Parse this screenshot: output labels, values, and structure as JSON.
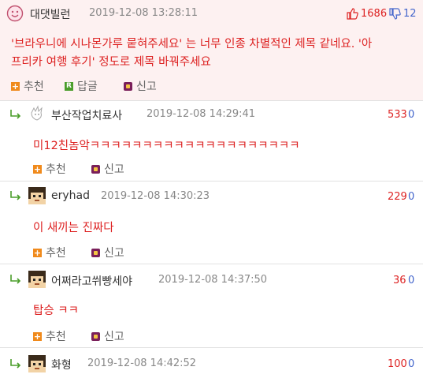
{
  "main_comment": {
    "nickname": "대댓빌런",
    "date": "2019-12-08 13:28:11",
    "upvotes": "1686",
    "downvotes": "12",
    "content_line1": "'브라우니에 시나몬가루 뭍혀주세요' 는 너무 인종 차별적인 제목 같네요. '아",
    "content_line2": "프리카 여행 후기' 정도로 제목 바꿔주세요",
    "recommend_label": "추천",
    "reply_label": "답글",
    "report_label": "신고"
  },
  "replies": [
    {
      "nickname": "부산작업치료사",
      "date": "2019-12-08 14:29:41",
      "upvotes": "533",
      "downvotes": "0",
      "content": "미12친놈악ㅋㅋㅋㅋㅋㅋㅋㅋㅋㅋㅋㅋㅋㅋㅋㅋㅋㅋㅋㅋ",
      "recommend_label": "추천",
      "report_label": "신고"
    },
    {
      "nickname": "eryhad",
      "date": "2019-12-08 14:30:23",
      "upvotes": "229",
      "downvotes": "0",
      "content": "이 새끼는 진짜다",
      "recommend_label": "추천",
      "report_label": "신고"
    },
    {
      "nickname": "어쩌라고쒸빵세야",
      "date": "2019-12-08 14:37:50",
      "upvotes": "36",
      "downvotes": "0",
      "content": "탑승 ㅋㅋ",
      "recommend_label": "추천",
      "report_label": "신고"
    },
    {
      "nickname": "화형",
      "date": "2019-12-08 14:42:52",
      "upvotes": "100",
      "downvotes": "0"
    }
  ],
  "colors": {
    "highlight_bg": "#fdf1f1",
    "content_red": "#d22",
    "down_blue": "#4466cc",
    "recommend_orange": "#f08a1c",
    "reply_green": "#4a9d2a"
  },
  "icons": {
    "avatar_main": "pink-face-avatar",
    "avatar_reply1": "spiky-sketch-avatar",
    "avatar_pixel": "pixel-face-avatar",
    "thumbs_up": "thumbs-up-icon",
    "thumbs_down": "thumbs-down-icon",
    "reply_arrow": "reply-arrow-icon"
  }
}
